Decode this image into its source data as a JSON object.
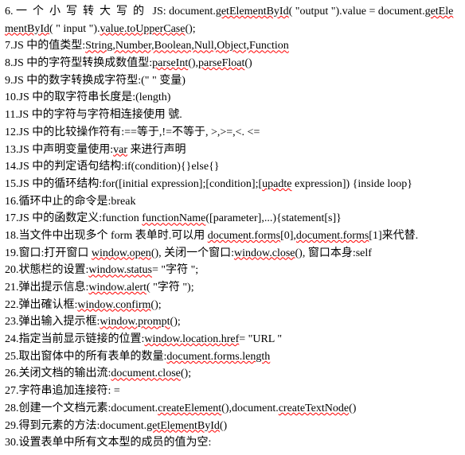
{
  "lines": [
    {
      "n": "6",
      "segs": [
        {
          "t": "6. ",
          "cls": ""
        },
        {
          "t": "一个小写转大写的",
          "cls": "spaced"
        },
        {
          "t": " JS:  ",
          "cls": ""
        },
        {
          "t": "document.",
          "cls": ""
        },
        {
          "t": "getElementById",
          "cls": "err"
        },
        {
          "t": "( \"output \").value = document.",
          "cls": ""
        },
        {
          "t": "getElementById",
          "cls": "err"
        },
        {
          "t": "( \" input \").",
          "cls": ""
        },
        {
          "t": "value.toUpperCase",
          "cls": "err"
        },
        {
          "t": "();",
          "cls": ""
        }
      ]
    },
    {
      "n": "7",
      "segs": [
        {
          "t": "7.JS 中的值类型:",
          "cls": ""
        },
        {
          "t": "String,Number,Boolean,Null,Object,Function",
          "cls": "err"
        }
      ]
    },
    {
      "n": "8",
      "segs": [
        {
          "t": "8.JS 中的字符型转换成数值型:",
          "cls": ""
        },
        {
          "t": "parseInt",
          "cls": "err"
        },
        {
          "t": "(),",
          "cls": ""
        },
        {
          "t": "parseFloat",
          "cls": "err"
        },
        {
          "t": "()",
          "cls": ""
        }
      ]
    },
    {
      "n": "9",
      "segs": [
        {
          "t": "9.JS 中的数字转换成字符型:(\" \" 变量)",
          "cls": ""
        }
      ]
    },
    {
      "n": "10",
      "segs": [
        {
          "t": "10.JS 中的取字符串长度是:(length)",
          "cls": ""
        }
      ]
    },
    {
      "n": "11",
      "segs": [
        {
          "t": "11.JS 中的字符与字符相连接使用  號.",
          "cls": ""
        }
      ]
    },
    {
      "n": "12",
      "segs": [
        {
          "t": "12.JS 中的比较操作符有:==等于,!=不等于, >,>=,<. <=",
          "cls": ""
        }
      ]
    },
    {
      "n": "13",
      "segs": [
        {
          "t": "13.JS 中声明变量使用:",
          "cls": ""
        },
        {
          "t": "var",
          "cls": "err"
        },
        {
          "t": " 来进行声明",
          "cls": ""
        }
      ]
    },
    {
      "n": "14",
      "segs": [
        {
          "t": "14.JS 中的判定语句结构:if(condition){}else{}",
          "cls": ""
        }
      ]
    },
    {
      "n": "15",
      "segs": [
        {
          "t": "15.JS 中的循环结构:for([initial expression];[condition];[",
          "cls": ""
        },
        {
          "t": "upadte",
          "cls": "err"
        },
        {
          "t": " expression]) {inside loop}",
          "cls": ""
        }
      ]
    },
    {
      "n": "16",
      "segs": [
        {
          "t": "16.循环中止的命令是:break",
          "cls": ""
        }
      ]
    },
    {
      "n": "17",
      "segs": [
        {
          "t": "17.JS 中的函数定义:function ",
          "cls": ""
        },
        {
          "t": "functionName",
          "cls": "err"
        },
        {
          "t": "([parameter],...){statement[s]}",
          "cls": ""
        }
      ]
    },
    {
      "n": "18",
      "segs": [
        {
          "t": "18.当文件中出现多个 form 表单时.可以用 ",
          "cls": ""
        },
        {
          "t": "document.forms",
          "cls": "err"
        },
        {
          "t": "[0],",
          "cls": ""
        },
        {
          "t": "document.forms",
          "cls": "err"
        },
        {
          "t": "[1]来代替.",
          "cls": ""
        }
      ]
    },
    {
      "n": "19",
      "segs": [
        {
          "t": "19.窗口:打开窗口 ",
          "cls": ""
        },
        {
          "t": "window.open",
          "cls": "err"
        },
        {
          "t": "(), 关闭一个窗口:",
          "cls": ""
        },
        {
          "t": "window.close",
          "cls": "err"
        },
        {
          "t": "(), 窗口本身:self",
          "cls": ""
        }
      ]
    },
    {
      "n": "20",
      "segs": [
        {
          "t": "20.状態栏的设置:",
          "cls": ""
        },
        {
          "t": "window.status",
          "cls": "err"
        },
        {
          "t": "= \"字符 \";",
          "cls": ""
        }
      ]
    },
    {
      "n": "21",
      "segs": [
        {
          "t": "21.弹出提示信息:",
          "cls": ""
        },
        {
          "t": "window.alert",
          "cls": "err"
        },
        {
          "t": "( \"字符  \");",
          "cls": ""
        }
      ]
    },
    {
      "n": "22",
      "segs": [
        {
          "t": "22.弹出確认框:",
          "cls": ""
        },
        {
          "t": "window.confirm",
          "cls": "err"
        },
        {
          "t": "();",
          "cls": ""
        }
      ]
    },
    {
      "n": "23",
      "segs": [
        {
          "t": "23.弹出输入提示框:",
          "cls": ""
        },
        {
          "t": "window.prompt",
          "cls": "err"
        },
        {
          "t": "();",
          "cls": ""
        }
      ]
    },
    {
      "n": "24",
      "segs": [
        {
          "t": "24.指定当前显示链接的位置:",
          "cls": ""
        },
        {
          "t": "window.location.href",
          "cls": "err"
        },
        {
          "t": "= \"URL \"",
          "cls": ""
        }
      ]
    },
    {
      "n": "25",
      "segs": [
        {
          "t": "25.取出窗体中的所有表单的数量:",
          "cls": ""
        },
        {
          "t": "document.forms.length",
          "cls": "err"
        }
      ]
    },
    {
      "n": "26",
      "segs": [
        {
          "t": "26.关闭文档的输出流:",
          "cls": ""
        },
        {
          "t": "document.close",
          "cls": "err"
        },
        {
          "t": "();",
          "cls": ""
        }
      ]
    },
    {
      "n": "27",
      "segs": [
        {
          "t": "27.字符串追加连接符: =",
          "cls": ""
        }
      ]
    },
    {
      "n": "28",
      "segs": [
        {
          "t": "28.创建一个文档元素:document.",
          "cls": ""
        },
        {
          "t": "createElement",
          "cls": "err"
        },
        {
          "t": "(),document.",
          "cls": ""
        },
        {
          "t": "createTextNode",
          "cls": "err"
        },
        {
          "t": "()",
          "cls": ""
        }
      ]
    },
    {
      "n": "29",
      "segs": [
        {
          "t": "29.得到元素的方法:document.",
          "cls": ""
        },
        {
          "t": "getElementById",
          "cls": "err"
        },
        {
          "t": "()",
          "cls": ""
        }
      ]
    },
    {
      "n": "30",
      "segs": [
        {
          "t": "30.设置表单中所有文本型的成员的值为空:",
          "cls": ""
        }
      ]
    }
  ]
}
